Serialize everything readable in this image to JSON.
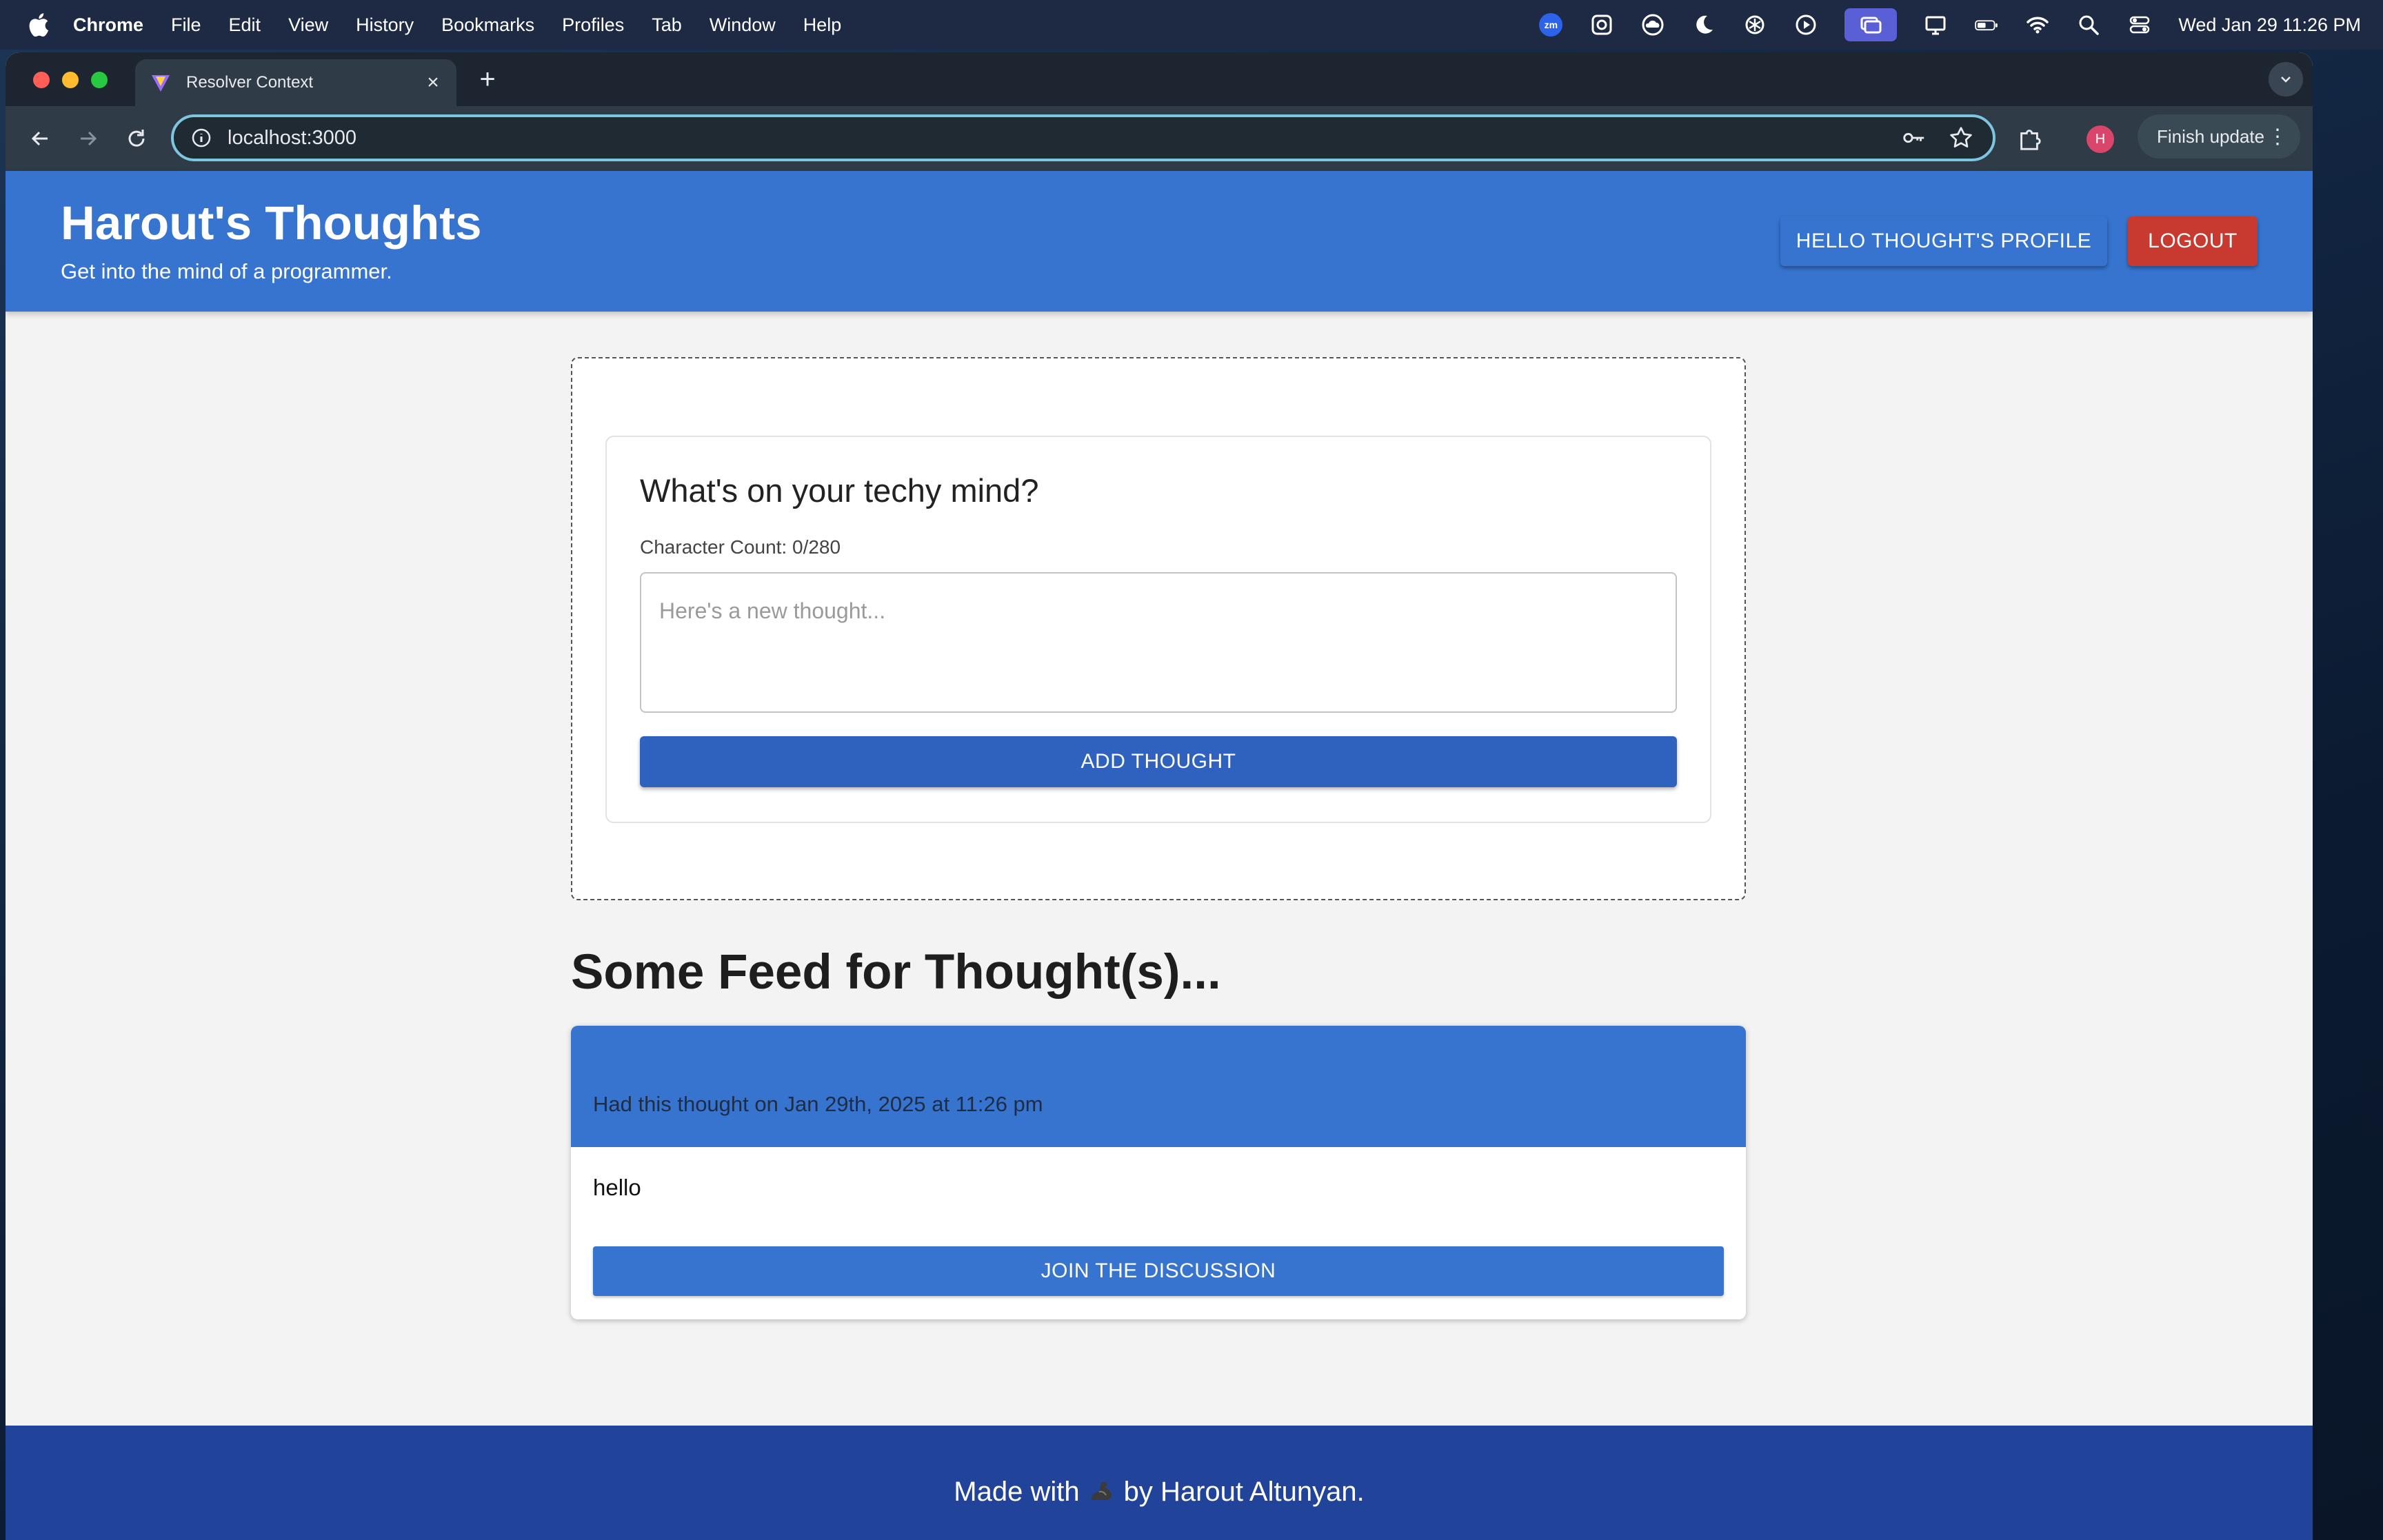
{
  "menubar": {
    "app": "Chrome",
    "items": [
      "File",
      "Edit",
      "View",
      "History",
      "Bookmarks",
      "Profiles",
      "Tab",
      "Window",
      "Help"
    ],
    "zoom_label": "zm",
    "clock": "Wed Jan 29  11:26 PM"
  },
  "browser": {
    "tab_title": "Resolver Context",
    "url": "localhost:3000",
    "profile_initial": "H",
    "finish_update": "Finish update"
  },
  "header": {
    "title": "Harout's Thoughts",
    "tagline": "Get into the mind of a programmer.",
    "profile_button": "HELLO THOUGHT'S PROFILE",
    "logout_button": "LOGOUT"
  },
  "thought_form": {
    "heading": "What's on your techy mind?",
    "char_count": "Character Count: 0/280",
    "placeholder": "Here's a new thought...",
    "submit": "ADD THOUGHT"
  },
  "feed": {
    "title": "Some Feed for Thought(s)...",
    "thoughts": [
      {
        "meta": "Had this thought on Jan 29th, 2025 at 11:26 pm",
        "text": "hello",
        "action": "JOIN THE DISCUSSION"
      }
    ]
  },
  "footer": {
    "before": "Made with",
    "after": "by Harout Altunyan."
  },
  "colors": {
    "primary": "#3674cf",
    "button_dark": "#2e62be",
    "logout": "#c8392f",
    "footer": "#21449a"
  }
}
